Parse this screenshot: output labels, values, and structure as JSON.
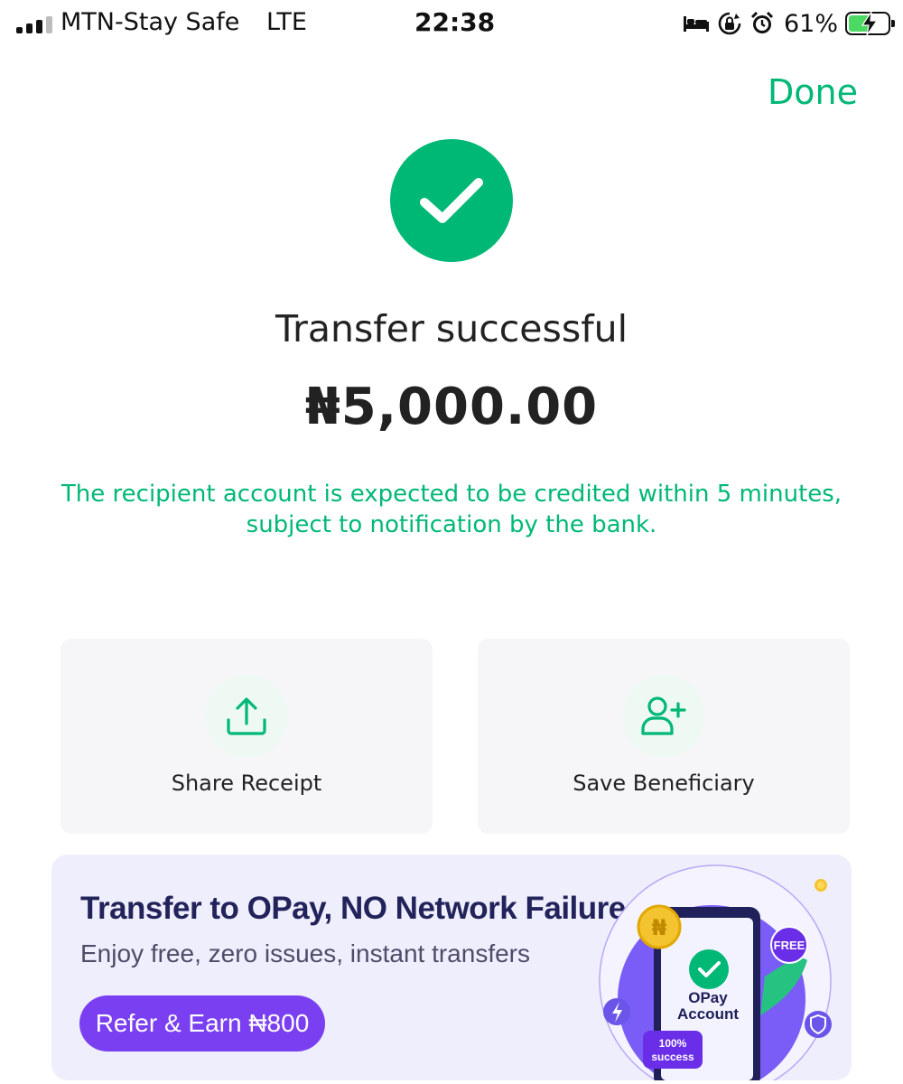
{
  "status_bar": {
    "carrier": "MTN-Stay Safe",
    "network": "LTE",
    "time": "22:38",
    "battery_percent": "61%",
    "battery_level": 0.61,
    "icons": [
      "signal-icon",
      "bed-icon",
      "rotation-lock-icon",
      "alarm-icon",
      "battery-charging-icon"
    ]
  },
  "header": {
    "done_label": "Done"
  },
  "result": {
    "title": "Transfer successful",
    "amount": "₦5,000.00",
    "note": "The recipient account is expected to be credited within 5 minutes, subject to notification by the bank."
  },
  "actions": [
    {
      "label": "Share Receipt",
      "icon": "share-icon"
    },
    {
      "label": "Save Beneficiary",
      "icon": "add-user-icon"
    }
  ],
  "promo": {
    "title": "Transfer to OPay, NO Network Failure",
    "subtitle": "Enjoy free, zero issues, instant transfers",
    "button_label": "Refer & Earn ₦800",
    "art": {
      "coin_symbol": "₦",
      "phone_title": "OPay Account",
      "badge_free": "FREE",
      "badge_success": "100% success"
    }
  },
  "colors": {
    "accent_green": "#00b875",
    "promo_purple": "#7a3ff0",
    "promo_bg": "#efeefc",
    "card_bg": "#f6f6f8"
  }
}
